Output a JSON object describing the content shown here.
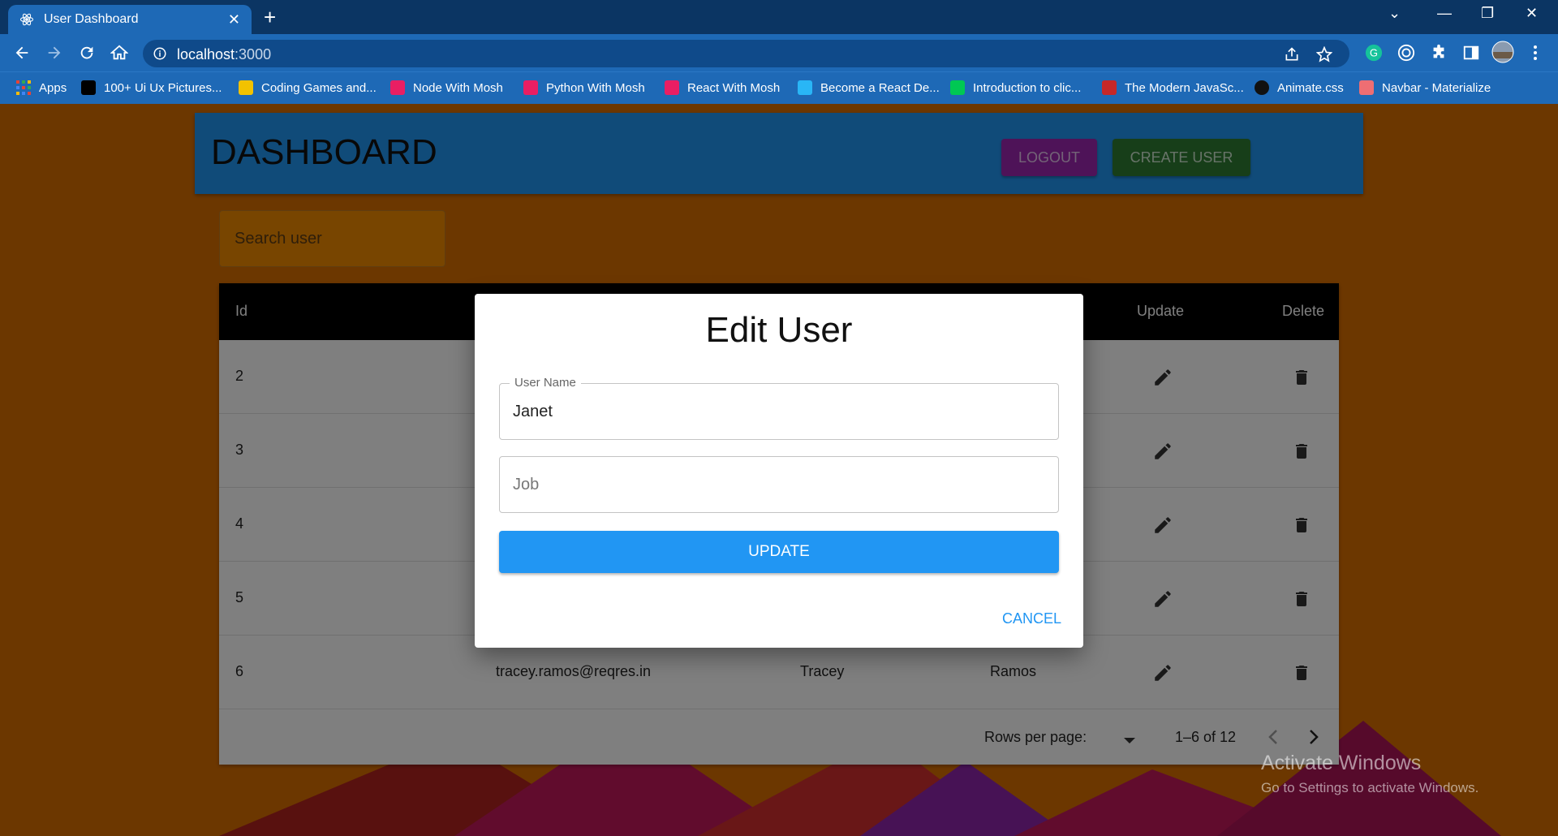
{
  "browser": {
    "tab_title": "User Dashboard",
    "url_host": "localhost",
    "url_port": ":3000"
  },
  "bookmarks": [
    {
      "label": "Apps",
      "color": "#e53935"
    },
    {
      "label": "100+ Ui Ux Pictures...",
      "color": "#000000"
    },
    {
      "label": "Coding Games and...",
      "color": "#f2c200"
    },
    {
      "label": "Node With Mosh",
      "color": "#e91e63"
    },
    {
      "label": "Python With Mosh",
      "color": "#e91e63"
    },
    {
      "label": "React With Mosh",
      "color": "#e91e63"
    },
    {
      "label": "Become a React De...",
      "color": "#29b6f6"
    },
    {
      "label": "Introduction to clic...",
      "color": "#00c853"
    },
    {
      "label": "The Modern JavaSc...",
      "color": "#c62828"
    },
    {
      "label": "Animate.css",
      "color": "#111111"
    },
    {
      "label": "Navbar - Materialize",
      "color": "#ee6e73"
    }
  ],
  "dashboard": {
    "title": "DASHBOARD",
    "logout_label": "LOGOUT",
    "create_label": "CREATE USER",
    "search_placeholder": "Search user"
  },
  "table": {
    "headers": {
      "id": "Id",
      "update": "Update",
      "delete": "Delete"
    },
    "rows": [
      {
        "id": "2",
        "email": "",
        "first": "",
        "last": ""
      },
      {
        "id": "3",
        "email": "",
        "first": "",
        "last": ""
      },
      {
        "id": "4",
        "email": "",
        "first": "",
        "last": ""
      },
      {
        "id": "5",
        "email": "",
        "first": "",
        "last": ""
      },
      {
        "id": "6",
        "email": "tracey.ramos@reqres.in",
        "first": "Tracey",
        "last": "Ramos"
      }
    ],
    "pagination": {
      "rows_per_page_label": "Rows per page:",
      "range": "1–6 of 12"
    }
  },
  "dialog": {
    "title": "Edit User",
    "name_label": "User Name",
    "name_value": "Janet",
    "job_placeholder": "Job",
    "update_label": "UPDATE",
    "cancel_label": "CANCEL"
  },
  "watermark": {
    "line1": "Activate Windows",
    "line2": "Go to Settings to activate Windows."
  },
  "colors": {
    "page_bg": "#d96e00",
    "appbar": "#2196f3",
    "logout": "#9c27b0",
    "create": "#2e7d32",
    "accent": "#2196f3"
  }
}
